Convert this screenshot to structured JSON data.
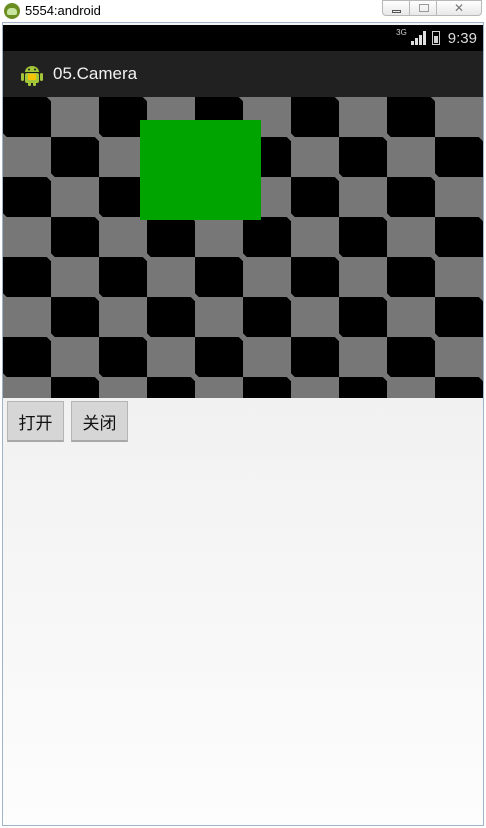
{
  "window": {
    "title": "5554:android",
    "close_glyph": "✕"
  },
  "statusbar": {
    "network": "3G",
    "time": "9:39"
  },
  "actionbar": {
    "title": "05.Camera"
  },
  "buttons": {
    "open_label": "打开",
    "close_label": "关闭"
  },
  "colors": {
    "accent_green": "#00a400",
    "checker_gray": "#777777",
    "checker_black": "#000000",
    "actionbar_bg": "#212121"
  },
  "icons": {
    "app": "android-icon",
    "signal": "signal-icon",
    "battery": "battery-icon"
  }
}
